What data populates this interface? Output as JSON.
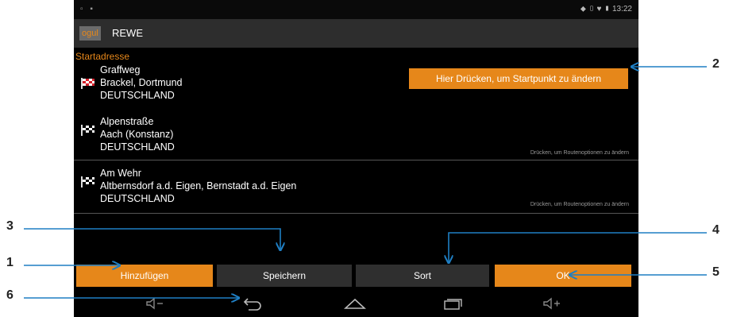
{
  "status_bar": {
    "time": "13:22"
  },
  "title_bar": {
    "logo_text": "ogul",
    "title": "REWE"
  },
  "section_label": "Startadresse",
  "change_start_button": "Hier Drücken, um Startpunkt zu ändern",
  "route_hint": "Drücken, um Routenoptionen zu ändern",
  "entries": [
    {
      "line1": "Graffweg",
      "line2": "Brackel, Dortmund",
      "line3": "DEUTSCHLAND",
      "flag_color": "#d4202a"
    },
    {
      "line1": "Alpenstraße",
      "line2": "Aach (Konstanz)",
      "line3": "DEUTSCHLAND",
      "flag_color": "#ffffff"
    },
    {
      "line1": "Am Wehr",
      "line2": "Altbernsdorf a.d. Eigen, Bernstadt a.d. Eigen",
      "line3": "DEUTSCHLAND",
      "flag_color": "#ffffff"
    }
  ],
  "buttons": {
    "add": "Hinzufügen",
    "save": "Speichern",
    "sort": "Sort",
    "ok": "OK"
  },
  "callouts": {
    "c1": "1",
    "c2": "2",
    "c3": "3",
    "c4": "4",
    "c5": "5",
    "c6": "6"
  },
  "colors": {
    "accent": "#e6871a",
    "callout_arrow": "#1f7fc4"
  }
}
